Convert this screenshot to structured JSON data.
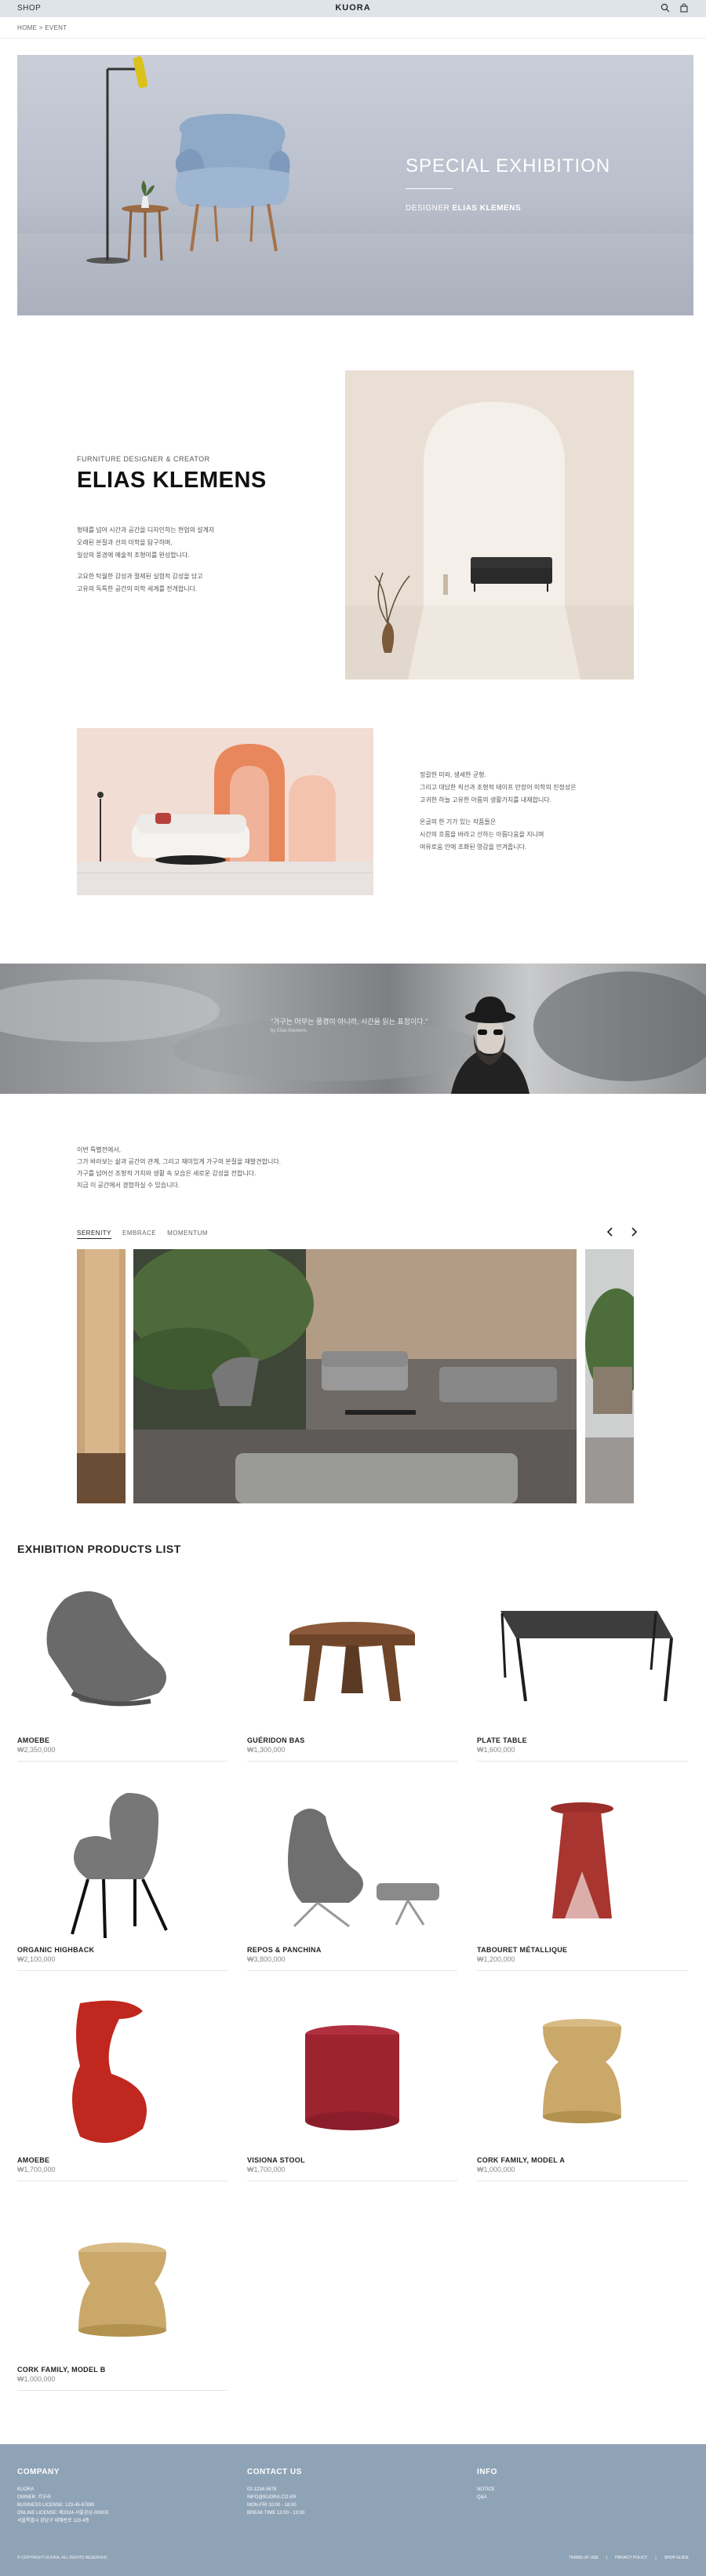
{
  "header": {
    "shop_label": "SHOP",
    "logo": "KUORA",
    "search_icon": "search-icon",
    "cart_icon": "bag-icon"
  },
  "breadcrumb": "HOME > EVENT",
  "hero": {
    "title": "SPECIAL EXHIBITION",
    "designer_prefix": "DESIGNER",
    "designer_name": "ELIAS KLEMENS"
  },
  "designer": {
    "subtitle": "FURNITURE DESIGNER & CREATOR",
    "name": "ELIAS KLEMENS",
    "para1": [
      "형태를 넘어 시간과 공간을 디자인하는 현업의 설계자",
      "오래된 본질과 선의 미학을 탐구하며,",
      "일상의 풍경에 예술적 조형미를 완성합니다."
    ],
    "para2": [
      "고요한 탁월한 감성과 절제된 실험적 감성을 담고",
      "고유의 독특한 공간의 미학 세계를 전개합니다."
    ]
  },
  "designer2": {
    "para1": [
      "정갈한 미와, 생세한 균형.",
      "그리고 대담한 직선과 조형적 테이프 만장어 미학의 진정성은",
      "고귀한 하늘 고유한 아름의 생활가치를 내재합니다."
    ],
    "para2": [
      "온글의 한 기가 있는 작품들은",
      "시간의 흐름을 바라고 선하는 아름다움을 지니며",
      "여유로움 안에 조화된 영감을 안겨줍니다."
    ]
  },
  "quote": {
    "text": "\"가구는 머무는 풍경이 아니라, 시간을 읽는 표정이다.\"",
    "author": "by Elias Klemens"
  },
  "intro": [
    "이번 특별전에서,",
    "그가 바라보는 삶과 공간의 관계, 그리고 재미있게 가구의 본질을 재발견합니다.",
    "가구를 넘어선 조형적 가치와 생활 속 모습은 새로운 감성을 전합니다.",
    "지금 이 공간에서 경험하실 수 있습니다."
  ],
  "tabs": [
    "SERENITY",
    "EMBRACE",
    "MOMENTUM"
  ],
  "products_title": "EXHIBITION PRODUCTS LIST",
  "products": [
    {
      "name": "AMOEBE",
      "price": "₩2,350,000"
    },
    {
      "name": "GUÉRIDON BAS",
      "price": "₩1,300,000"
    },
    {
      "name": "PLATE TABLE",
      "price": "₩1,600,000"
    },
    {
      "name": "ORGANIC HIGHBACK",
      "price": "₩2,100,000"
    },
    {
      "name": "REPOS & PANCHINA",
      "price": "₩3,800,000"
    },
    {
      "name": "TABOURET MÉTALLIQUE",
      "price": "₩1,200,000"
    },
    {
      "name": "AMOEBE",
      "price": "₩1,700,000"
    },
    {
      "name": "VISIONA STOOL",
      "price": "₩1,700,000"
    },
    {
      "name": "CORK FAMILY, MODEL A",
      "price": "₩1,000,000"
    },
    {
      "name": "CORK FAMILY, MODEL B",
      "price": "₩1,000,000"
    }
  ],
  "footer": {
    "company": {
      "title": "COMPANY",
      "lines": [
        "KUORA",
        "OWNER: 키우라",
        "BUSINESS LICENSE: 123-45-67890",
        "ONLINE LICENSE: 제2024-서울강남-0000호",
        "서울특별시 강남구 테헤란로 123 4층"
      ]
    },
    "contact": {
      "title": "CONTACT US",
      "lines": [
        "02-1234-5678",
        "INFO@KUORA.CO.KR",
        "MON-FRI 10:00 - 18:00",
        "BREAK TIME 12:00 - 13:00"
      ]
    },
    "info": {
      "title": "INFO",
      "lines": [
        "NOTICE",
        "Q&A"
      ]
    },
    "copyright": "© COPYRIGHT KUORA. ALL RIGHTS RESERVED.",
    "links": [
      "TERMS OF USE",
      "|",
      "PRIVACY POLICY",
      "|",
      "SHOP GUIDE"
    ]
  },
  "colors": {
    "topbar": "#dfe4ea",
    "footer": "#8fa3b7",
    "accent_red": "#b0342c",
    "cork": "#c9a86a"
  }
}
